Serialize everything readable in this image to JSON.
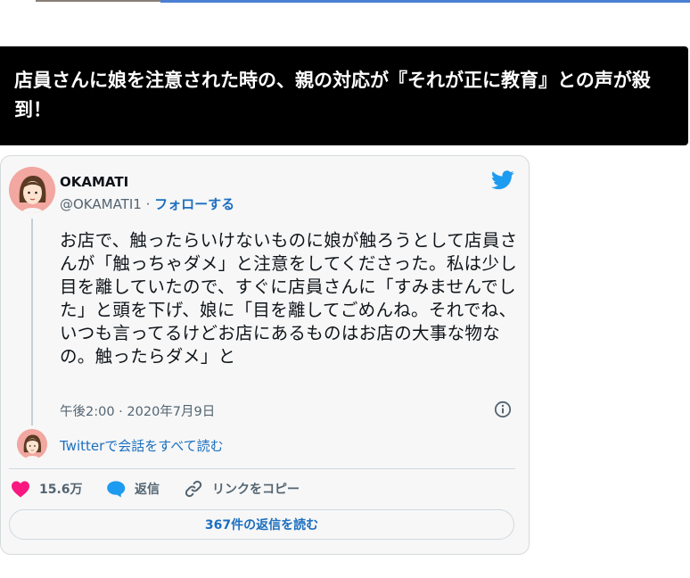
{
  "article": {
    "headline": "店員さんに娘を注意された時の、親の対応が『それが正に教育』との声が殺到！"
  },
  "tweet": {
    "display_name": "OKAMATI",
    "handle": "@OKAMATI1",
    "separator": " · ",
    "follow_label": "フォローする",
    "text": "お店で、触ったらいけないものに娘が触ろうとして店員さんが「触っちゃダメ」と注意をしてくださった。私は少し目を離していたので、すぐに店員さんに「すみませんでした」と頭を下げ、娘に「目を離してごめんね。それでね、いつも言ってるけどお店にあるものはお店の大事な物なの。触ったらダメ」と",
    "timestamp": "午後2:00 · 2020年7月9日",
    "read_conversation_label": "Twitterで会話をすべて読む",
    "likes": "15.6万",
    "reply_label": "返信",
    "copy_link_label": "リンクをコピー",
    "read_replies_label": "367件の返信を読む"
  },
  "icons": {
    "brand": "twitter-bird-icon",
    "like": "heart-icon",
    "reply": "speech-bubble-icon",
    "copy": "link-icon",
    "info": "info-icon"
  },
  "colors": {
    "twitter_blue": "#1d9bf0",
    "link_blue": "#1b6fc0",
    "heart": "#f91880",
    "headline_bg": "#000000"
  }
}
